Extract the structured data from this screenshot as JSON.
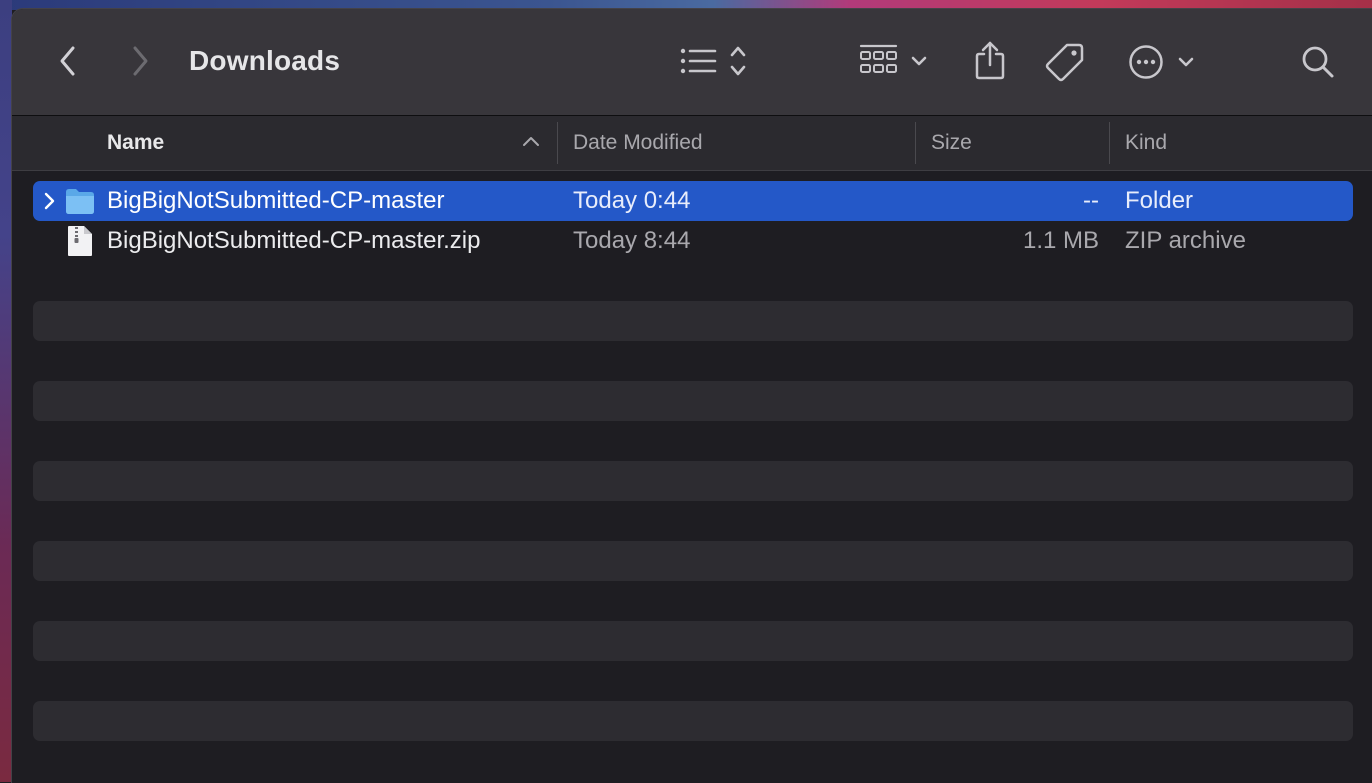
{
  "window": {
    "title": "Downloads"
  },
  "toolbar": {
    "back_icon": "chevron-left-icon",
    "forward_icon": "chevron-right-icon",
    "view_icon": "list-view-icon",
    "group_icon": "icon-grid-icon",
    "share_icon": "share-icon",
    "tag_icon": "tag-icon",
    "more_icon": "ellipsis-circle-icon",
    "search_icon": "search-icon"
  },
  "columns": {
    "name": "Name",
    "date": "Date Modified",
    "size": "Size",
    "kind": "Kind"
  },
  "files": [
    {
      "name": "BigBigNotSubmitted-CP-master",
      "date": "Today 0:44",
      "size": "--",
      "kind": "Folder",
      "icon": "folder-icon",
      "selected": true
    },
    {
      "name": "BigBigNotSubmitted-CP-master.zip",
      "date": "Today 8:44",
      "size": "1.1 MB",
      "kind": "ZIP archive",
      "icon": "zip-file-icon",
      "selected": false
    }
  ],
  "colors": {
    "selection": "#2458c8",
    "folder": "#5aa8e8"
  }
}
